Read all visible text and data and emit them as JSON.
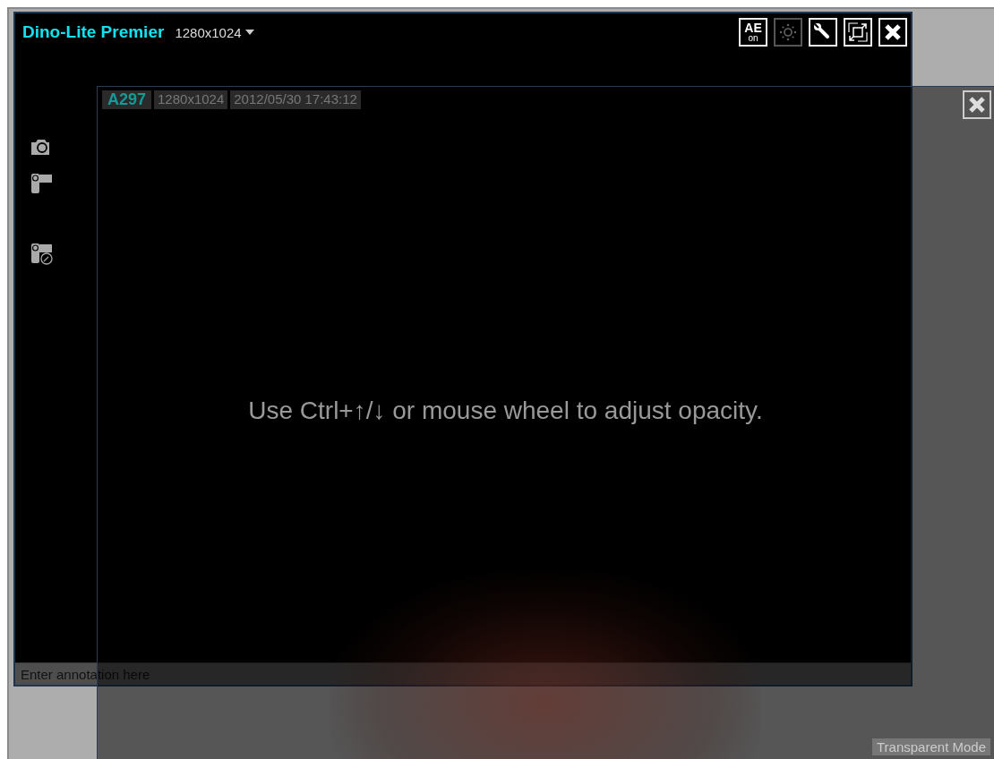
{
  "main_window": {
    "title": "Dino-Lite Premier",
    "resolution": "1280x1024",
    "toolbar": [
      {
        "kind": "ae",
        "label_top": "AE",
        "label_bottom": "on",
        "disabled": false
      },
      {
        "kind": "brightness",
        "disabled": true
      },
      {
        "kind": "settings",
        "disabled": false
      },
      {
        "kind": "resize",
        "disabled": false
      },
      {
        "kind": "close",
        "disabled": false
      }
    ],
    "side_tools": [
      {
        "kind": "camera"
      },
      {
        "kind": "video"
      },
      {
        "kind": "timer-video"
      }
    ],
    "annotation": {
      "placeholder": "Enter annotation here"
    }
  },
  "overlay": {
    "device": "A297",
    "resolution": "1280x1024",
    "timestamp": "2012/05/30 17:43:12",
    "hint": "Use Ctrl+↑/↓ or mouse wheel to adjust opacity.",
    "mode_label": "Transparent Mode"
  }
}
